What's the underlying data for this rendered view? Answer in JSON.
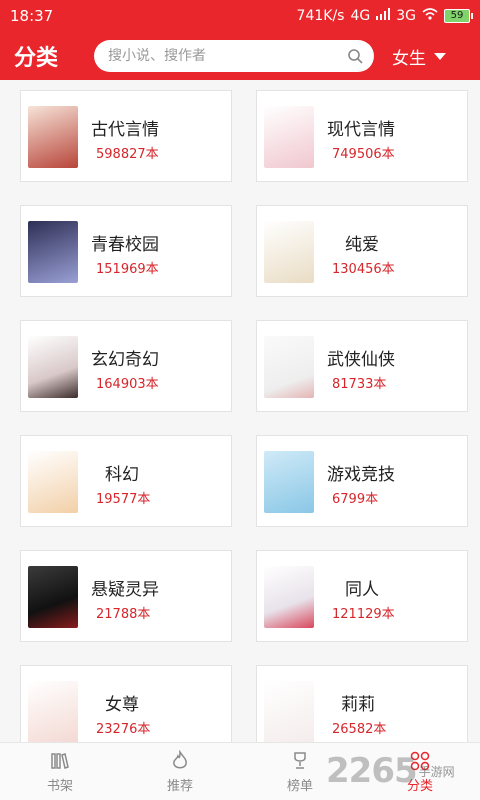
{
  "status_bar": {
    "time": "18:37",
    "speed": "741K/s",
    "net1": "4G",
    "net2": "3G",
    "battery": "59"
  },
  "header": {
    "title": "分类",
    "search_placeholder": "搜小说、搜作者",
    "gender": "女生"
  },
  "categories": [
    {
      "name": "古代言情",
      "count": "598827本",
      "cover_color": "#b8453a"
    },
    {
      "name": "现代言情",
      "count": "749506本",
      "cover_color": "#f0c7cf"
    },
    {
      "name": "青春校园",
      "count": "151969本",
      "cover_color": "#4a4f86"
    },
    {
      "name": "纯爱",
      "count": "130456本",
      "cover_color": "#e9dcc4"
    },
    {
      "name": "玄幻奇幻",
      "count": "164903本",
      "cover_color": "#d9c9c9"
    },
    {
      "name": "武侠仙侠",
      "count": "81733本",
      "cover_color": "#eeeeee"
    },
    {
      "name": "科幻",
      "count": "19577本",
      "cover_color": "#f2d0a8"
    },
    {
      "name": "游戏竞技",
      "count": "6799本",
      "cover_color": "#8ac7e6"
    },
    {
      "name": "悬疑灵异",
      "count": "21788本",
      "cover_color": "#1d1d1d"
    },
    {
      "name": "同人",
      "count": "121129本",
      "cover_color": "#e8e2ea"
    },
    {
      "name": "女尊",
      "count": "23276本",
      "cover_color": "#f3d9d3"
    },
    {
      "name": "莉莉",
      "count": "26582本",
      "cover_color": "#f4ecec"
    }
  ],
  "tabs": [
    {
      "label": "书架",
      "icon": "bookshelf-icon"
    },
    {
      "label": "推荐",
      "icon": "flame-icon"
    },
    {
      "label": "榜单",
      "icon": "trophy-icon"
    },
    {
      "label": "分类",
      "icon": "category-icon",
      "active": true
    }
  ],
  "watermark": {
    "number": "2265",
    "text": "手游网"
  },
  "colors": {
    "accent": "#e8262c",
    "count_text": "#d6262b"
  }
}
